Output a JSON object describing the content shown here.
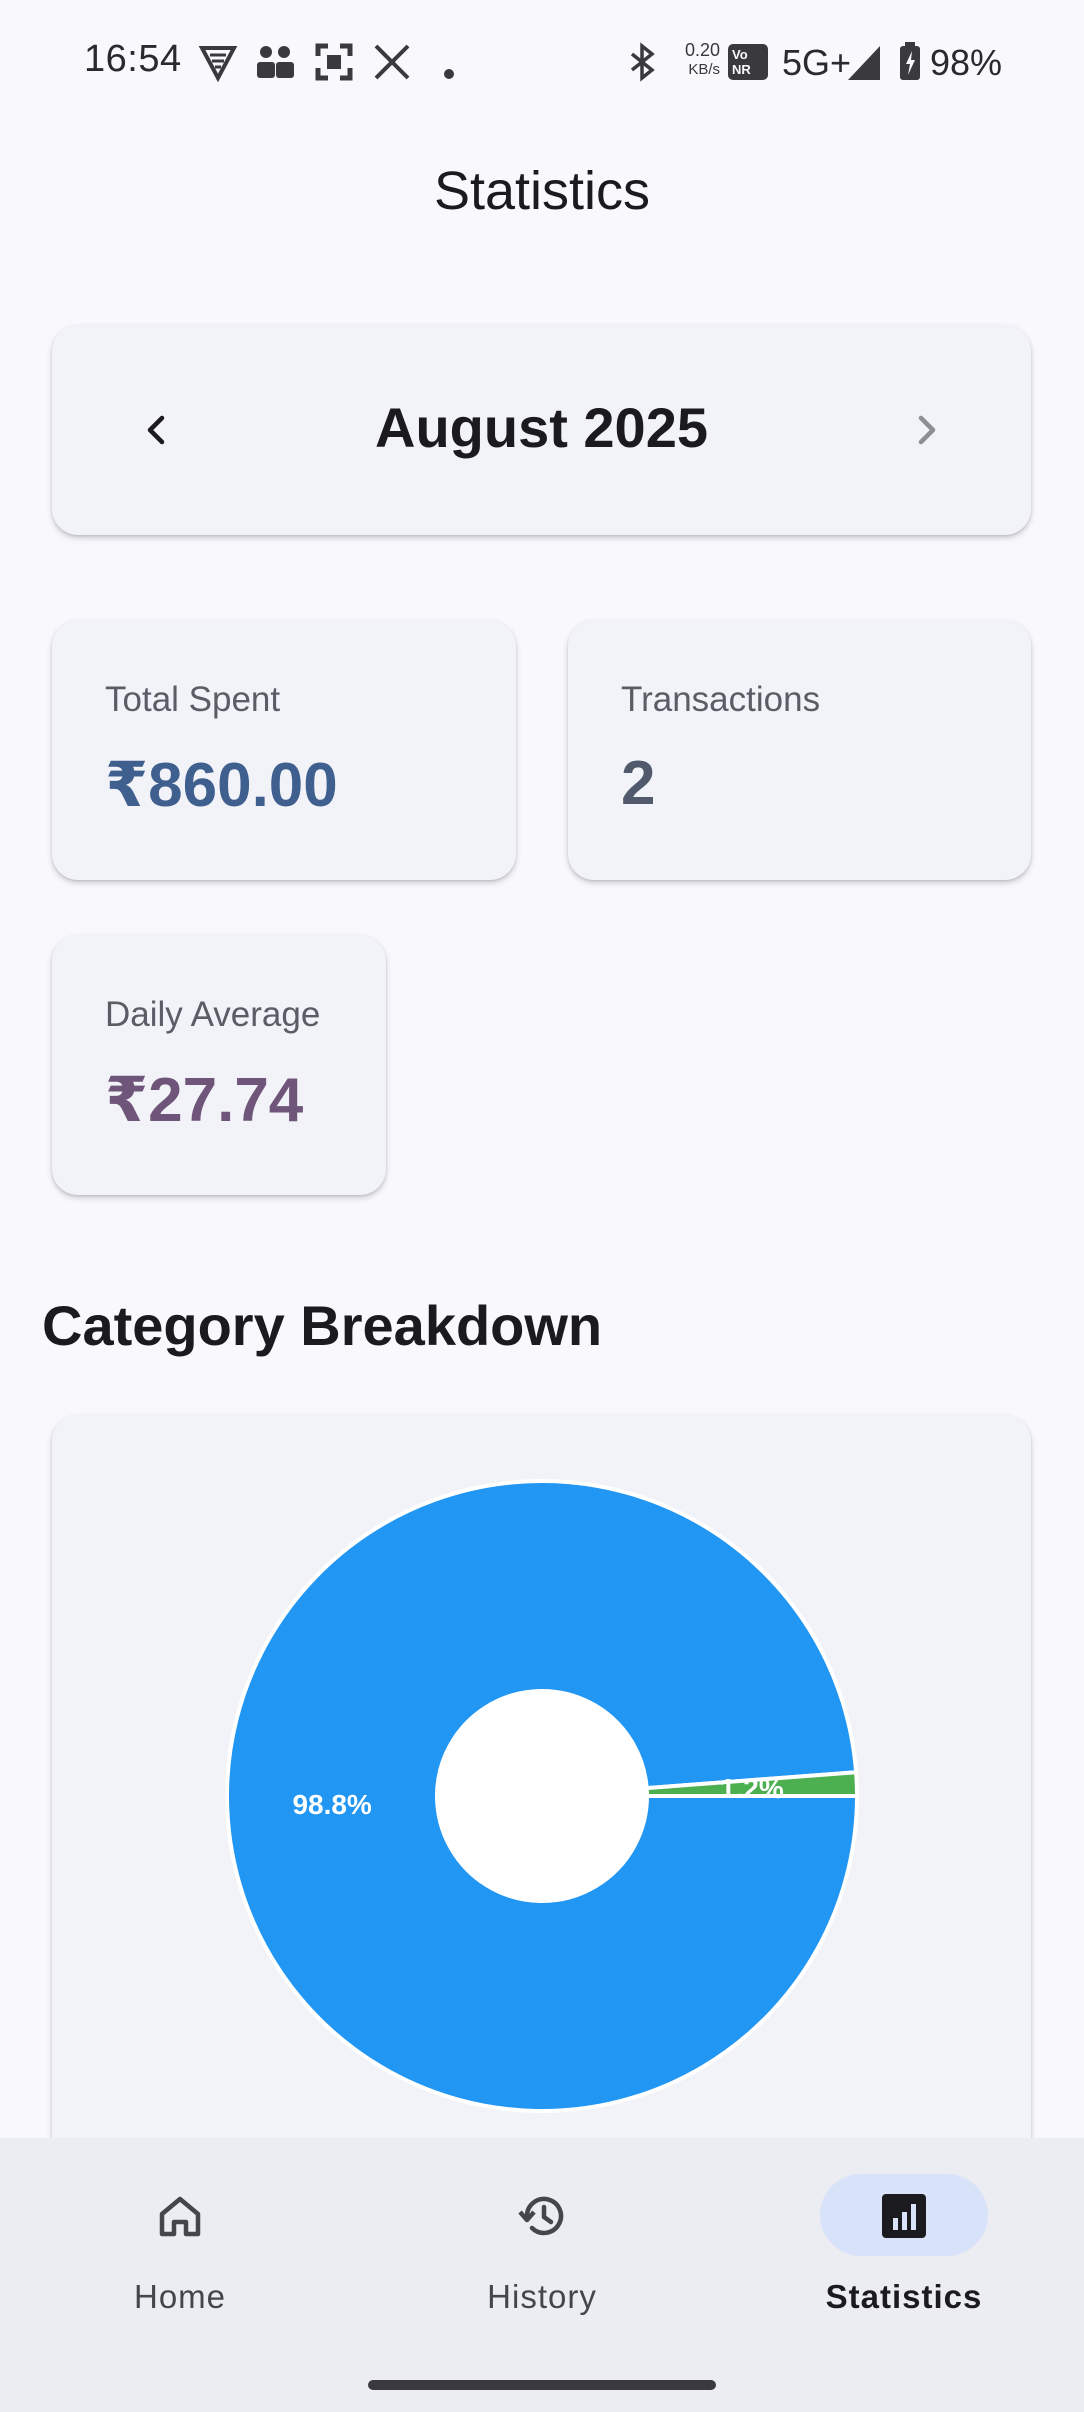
{
  "status_bar": {
    "time": "16:54",
    "net_speed_value": "0.20",
    "net_speed_unit": "KB/s",
    "volte_label": "Vo NR",
    "network": "5G+",
    "battery": "98%",
    "icons": [
      "vpn-icon",
      "contacts-icon",
      "scan-icon",
      "x-app-icon",
      "dot-icon",
      "bluetooth-icon",
      "volte-icon",
      "signal-icon",
      "battery-icon"
    ]
  },
  "header": {
    "title": "Statistics"
  },
  "month_selector": {
    "label": "August 2025",
    "prev_icon": "chevron-left-icon",
    "next_icon": "chevron-right-icon"
  },
  "stats": {
    "total_spent": {
      "label": "Total Spent",
      "value": "₹860.00",
      "color": "#3f5f8f"
    },
    "transactions": {
      "label": "Transactions",
      "value": "2",
      "color": "#505a6c"
    },
    "daily_average": {
      "label": "Daily Average",
      "value": "₹27.74",
      "color": "#6f5579"
    }
  },
  "breakdown": {
    "title": "Category Breakdown"
  },
  "chart_data": {
    "type": "pie",
    "donut": true,
    "slices": [
      {
        "label": "98.8%",
        "value": 98.8,
        "color": "#2196f3"
      },
      {
        "label": "1.2%",
        "value": 1.2,
        "color": "#4caf50"
      }
    ]
  },
  "bottom_nav": {
    "items": [
      {
        "label": "Home",
        "icon": "home-icon",
        "active": false
      },
      {
        "label": "History",
        "icon": "history-icon",
        "active": false
      },
      {
        "label": "Statistics",
        "icon": "bar-chart-icon",
        "active": true
      }
    ],
    "active_pill_color": "#d8e2f8"
  }
}
